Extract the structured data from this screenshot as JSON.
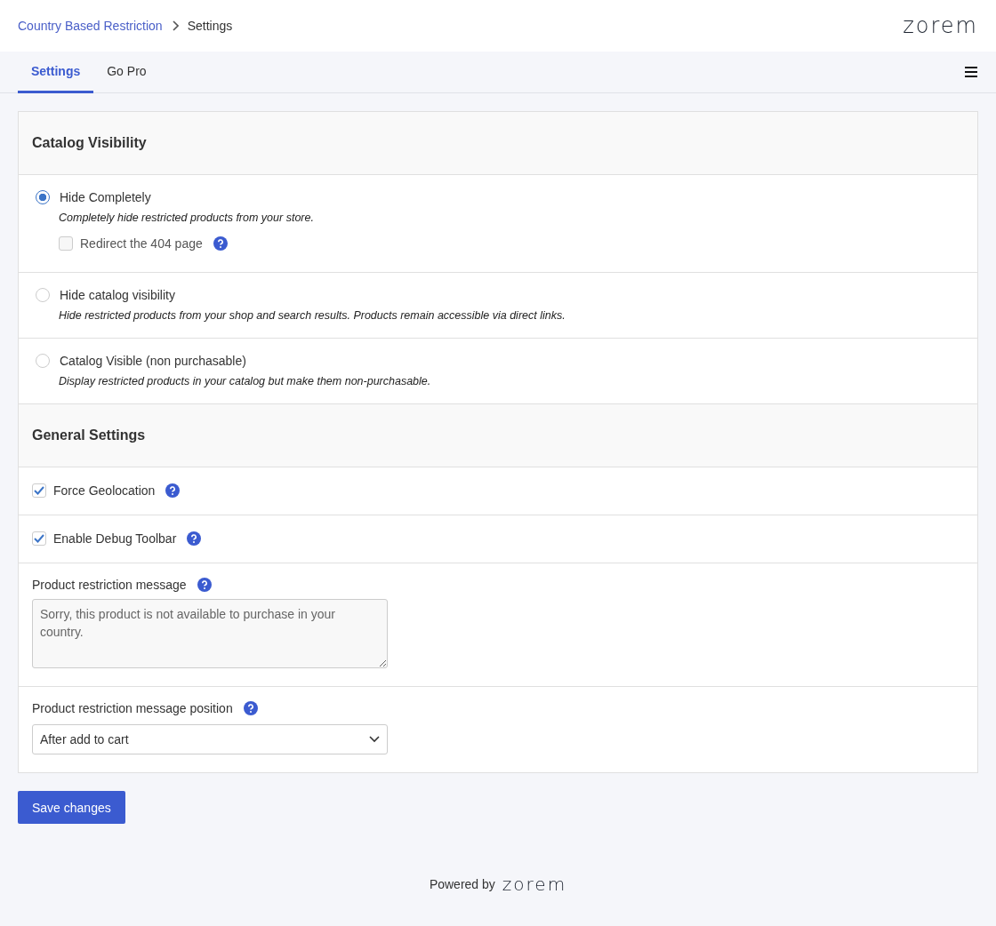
{
  "breadcrumb": {
    "parent": "Country Based Restriction",
    "current": "Settings"
  },
  "logo": "zorem",
  "tabs": [
    {
      "label": "Settings",
      "selected": true
    },
    {
      "label": "Go Pro",
      "selected": false
    }
  ],
  "sections": [
    {
      "kind": "radio-group",
      "title": "Catalog Visibility",
      "options": [
        {
          "label": "Hide Completely",
          "description": "Completely hide restricted products from your store.",
          "selected": true,
          "suboption": {
            "label": "Redirect the 404 page",
            "checked": false,
            "help": true
          }
        },
        {
          "label": "Hide catalog visibility",
          "description": "Hide restricted products from your shop and search results. Products remain accessible via direct links.",
          "selected": false
        },
        {
          "label": "Catalog Visible (non purchasable)",
          "description": "Display restricted products in your catalog but make them non-purchasable.",
          "selected": false
        }
      ]
    },
    {
      "kind": "settings",
      "title": "General Settings",
      "rows": [
        {
          "kind": "checkbox",
          "label": "Force Geolocation",
          "checked": true,
          "help": true
        },
        {
          "kind": "checkbox",
          "label": "Enable Debug Toolbar",
          "checked": true,
          "help": true
        },
        {
          "kind": "textarea",
          "label": "Product restriction message",
          "value": "Sorry, this product is not available to purchase in your country.",
          "help": true
        },
        {
          "kind": "select",
          "label": "Product restriction message position",
          "value": "After add to cart",
          "help": true
        }
      ]
    }
  ],
  "save_button": "Save changes",
  "footer": {
    "text": "Powered by",
    "logo": "zorem"
  }
}
